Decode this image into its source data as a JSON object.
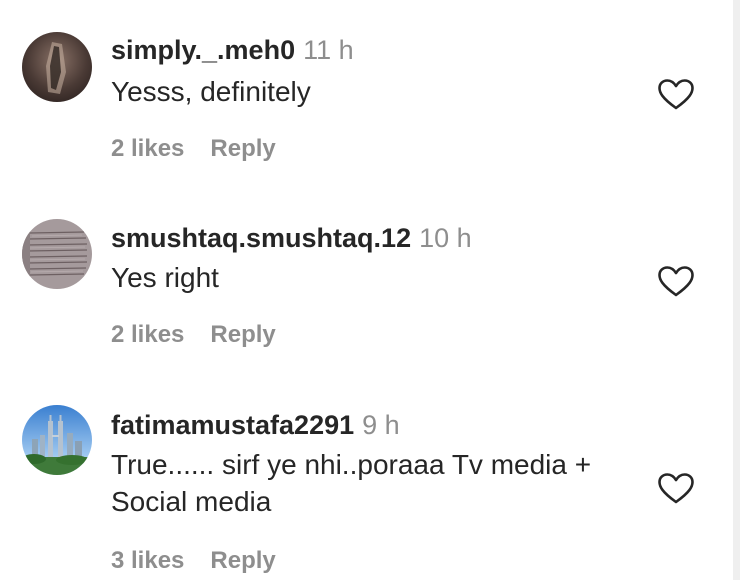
{
  "comments": [
    {
      "username": "simply._.meh0",
      "time": "11 h",
      "text": "Yesss, definitely",
      "likes": "2 likes",
      "reply": "Reply",
      "avatar_icon": "dark-photo-avatar"
    },
    {
      "username": "smushtaq.smushtaq.12",
      "time": "10 h",
      "text": "Yes right",
      "likes": "2 likes",
      "reply": "Reply",
      "avatar_icon": "handwritten-page-avatar"
    },
    {
      "username": "fatimamustafa2291",
      "time": "9 h",
      "text": "True...... sirf ye nhi..poraaa Tv media + Social media",
      "likes": "3 likes",
      "reply": "Reply",
      "avatar_icon": "city-skyline-avatar"
    }
  ],
  "colors": {
    "primary_text": "#262626",
    "secondary_text": "#8e8e8e",
    "background": "#ffffff"
  }
}
